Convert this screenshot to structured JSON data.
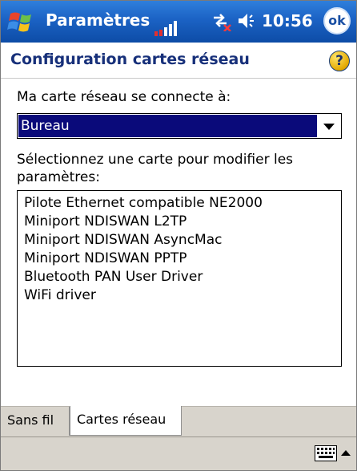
{
  "titlebar": {
    "app_title": "Paramètres",
    "time": "10:56",
    "ok_label": "ok",
    "icons": [
      "windows-flag-icon",
      "signal-bars-icon",
      "connectivity-icon",
      "volume-icon"
    ]
  },
  "header": {
    "title": "Configuration cartes réseau",
    "help_label": "?"
  },
  "content": {
    "connect_label": "Ma carte réseau se connecte à:",
    "connect_value": "Bureau",
    "select_label_line1": "Sélectionnez une carte pour modifier les",
    "select_label_line2": "paramètres:",
    "adapters": [
      "Pilote Ethernet compatible NE2000",
      "Miniport NDISWAN L2TP",
      "Miniport NDISWAN AsyncMac",
      "Miniport NDISWAN PPTP",
      "Bluetooth PAN User Driver",
      "WiFi driver"
    ]
  },
  "tabs": [
    {
      "label": "Sans fil",
      "selected": false
    },
    {
      "label": "Cartes réseau",
      "selected": true
    }
  ],
  "menubar": {
    "icons": [
      "keyboard-icon",
      "sip-up-arrow-icon"
    ]
  },
  "colors": {
    "titlebar": "#1b62c4",
    "header_title": "#17307a",
    "selection": "#0a0a7a"
  }
}
